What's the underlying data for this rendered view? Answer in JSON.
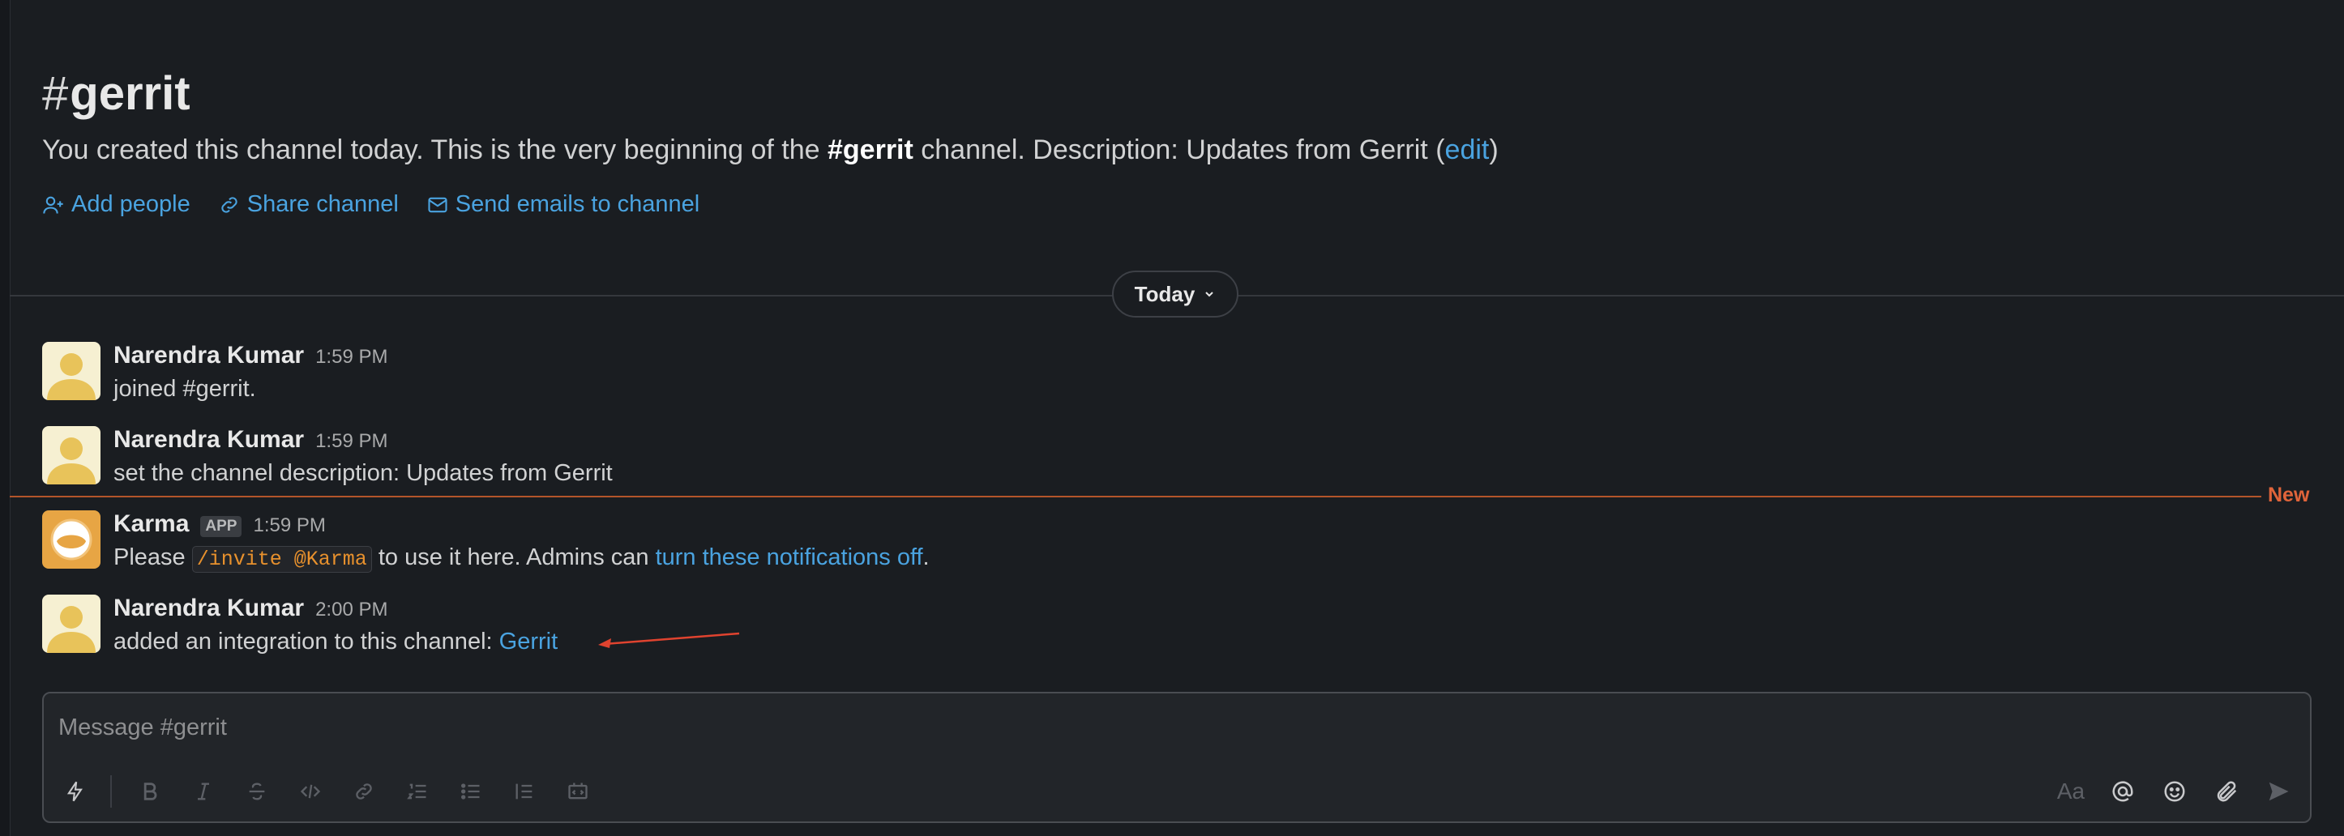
{
  "channel": {
    "hash": "#",
    "name": "gerrit",
    "intro_prefix": "You created this channel today. This is the very beginning of the ",
    "intro_channel": "#gerrit",
    "intro_suffix": " channel. Description: Updates from Gerrit (",
    "intro_edit": "edit",
    "intro_close": ")"
  },
  "actions": {
    "add_people": "Add people",
    "share_channel": "Share channel",
    "send_emails": "Send emails to channel"
  },
  "divider": {
    "label": "Today"
  },
  "new_marker": "New",
  "messages": [
    {
      "author": "Narendra Kumar",
      "time": "1:59 PM",
      "text": "joined #gerrit."
    },
    {
      "author": "Narendra Kumar",
      "time": "1:59 PM",
      "text": "set the channel description: Updates from Gerrit"
    },
    {
      "author": "Karma",
      "badge": "APP",
      "time": "1:59 PM",
      "text_before": "Please ",
      "code": "/invite @Karma",
      "text_middle": " to use it here. Admins can ",
      "link": "turn these notifications off",
      "text_after": "."
    },
    {
      "author": "Narendra Kumar",
      "time": "2:00 PM",
      "text": "added an integration to this channel: ",
      "link": "Gerrit"
    }
  ],
  "composer": {
    "placeholder": "Message #gerrit",
    "format_label": "Aa"
  },
  "icons": {
    "shortcuts": "lightning-icon",
    "bold": "bold-icon",
    "italic": "italic-icon",
    "strike": "strikethrough-icon",
    "code": "code-icon",
    "link": "link-icon",
    "ordered": "ordered-list-icon",
    "bulleted": "bulleted-list-icon",
    "blockquote": "blockquote-icon",
    "codeblock": "code-block-icon",
    "mention": "at-icon",
    "emoji": "emoji-icon",
    "attach": "paperclip-icon",
    "send": "send-icon"
  },
  "colors": {
    "background": "#1a1d21",
    "link": "#4aa3e0",
    "new_line": "#b3542a",
    "new_label": "#e0643a",
    "code": "#e8912d",
    "avatar_bg": "#f6f0d2",
    "avatar_fg": "#e8c35a",
    "karma_bg": "#e7a544"
  }
}
